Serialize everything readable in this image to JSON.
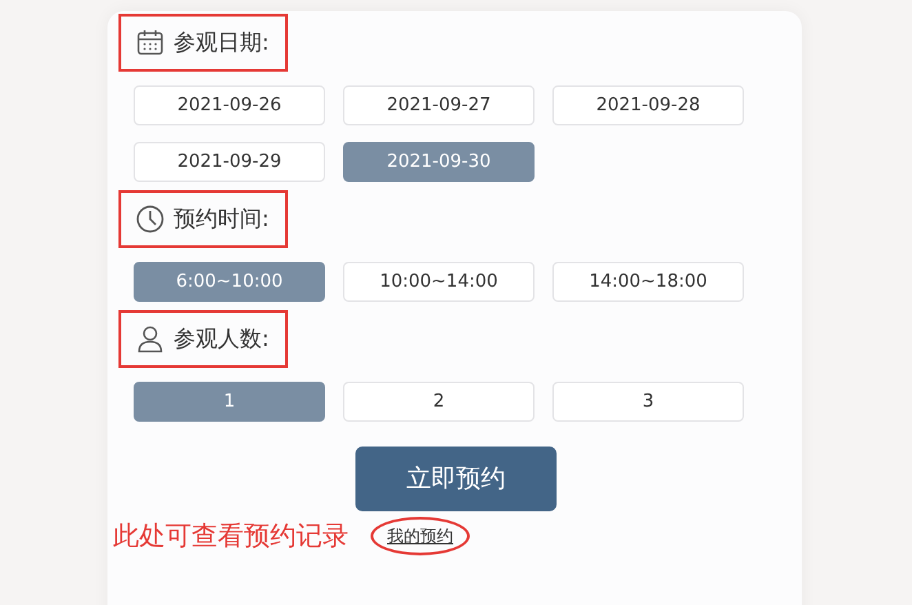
{
  "sections": [
    {
      "kind": "calendar",
      "heading": "参观日期:",
      "highlighted": true,
      "options": [
        {
          "label": "2021-09-26",
          "selected": false
        },
        {
          "label": "2021-09-27",
          "selected": false
        },
        {
          "label": "2021-09-28",
          "selected": false
        },
        {
          "label": "2021-09-29",
          "selected": false
        },
        {
          "label": "2021-09-30",
          "selected": true
        }
      ]
    },
    {
      "kind": "clock",
      "heading": "预约时间:",
      "highlighted": true,
      "options": [
        {
          "label": "6:00~10:00",
          "selected": true
        },
        {
          "label": "10:00~14:00",
          "selected": false
        },
        {
          "label": "14:00~18:00",
          "selected": false
        }
      ]
    },
    {
      "kind": "person",
      "heading": "参观人数:",
      "highlighted": true,
      "options": [
        {
          "label": "1",
          "selected": true
        },
        {
          "label": "2",
          "selected": false
        },
        {
          "label": "3",
          "selected": false
        }
      ]
    }
  ],
  "submit_button": "立即预约",
  "footer": {
    "note": "此处可查看预约记录",
    "link": "我的预约",
    "circled": true
  }
}
